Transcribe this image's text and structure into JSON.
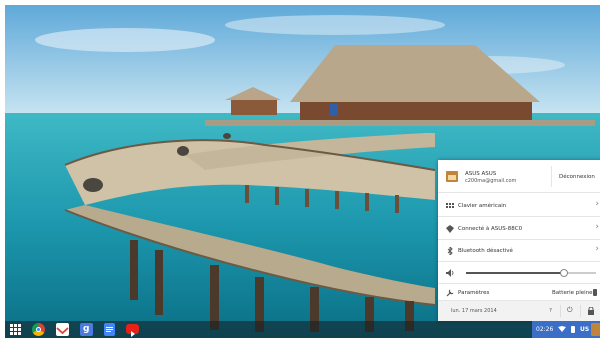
{
  "account": {
    "name": "ASUS ASUS",
    "email": "c200ma@gmail.com",
    "signout_label": "Déconnexion"
  },
  "tray_items": {
    "keyboard": "Clavier américain",
    "network": "Connecté à ASUS-88C0",
    "bluetooth": "Bluetooth désactivé",
    "settings": "Paramètres",
    "battery": "Batterie pleine"
  },
  "volume": {
    "level": 0.75
  },
  "footer": {
    "date": "lun. 17 mars 2014",
    "help": "?"
  },
  "status_area": {
    "time": "02:26",
    "ime": "US"
  },
  "shelf": {
    "apps": [
      "apps-launcher-icon",
      "chrome-icon",
      "gmail-icon",
      "google-search-icon",
      "docs-icon",
      "youtube-icon"
    ]
  },
  "colors": {
    "accent": "#3a6ec7",
    "sea": "#1fa3b5",
    "sky": "#8fcbe8"
  }
}
